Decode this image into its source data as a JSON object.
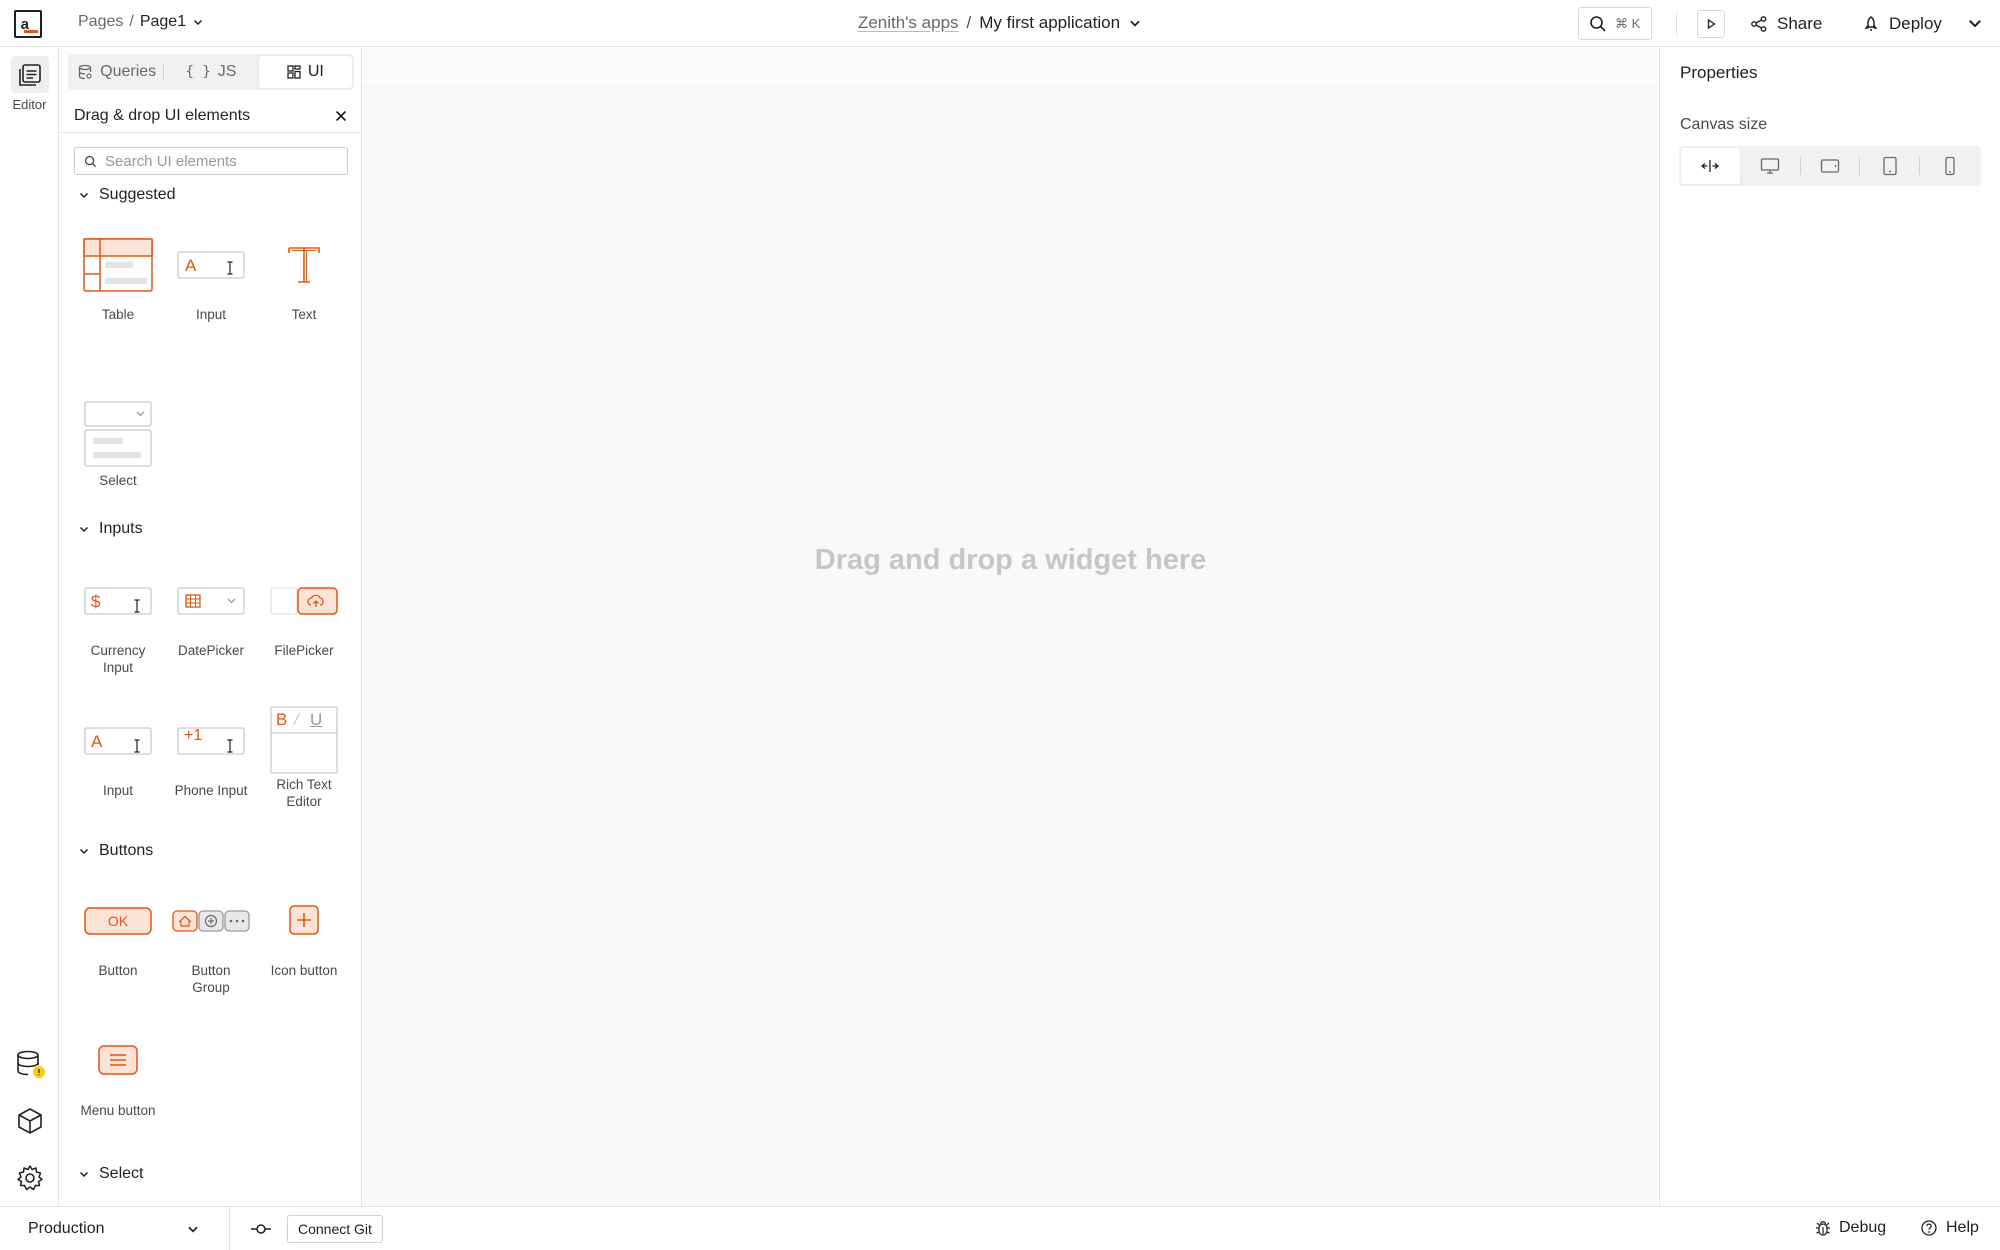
{
  "topbar": {
    "logo_text": "a_",
    "breadcrumb_root": "Pages",
    "breadcrumb_sep": "/",
    "breadcrumb_page": "Page1",
    "workspace": "Zenith's apps",
    "title_sep": "/",
    "app_name": "My first application",
    "search_shortcut": "⌘ K",
    "share_label": "Share",
    "deploy_label": "Deploy"
  },
  "rail": {
    "editor_label": "Editor"
  },
  "panel": {
    "tabs": [
      {
        "label": "Queries",
        "icon": "database-icon"
      },
      {
        "label": "JS",
        "icon": "braces-icon"
      },
      {
        "label": "UI",
        "icon": "grid-icon"
      }
    ],
    "active_tab": "UI",
    "heading": "Drag & drop UI elements",
    "search_placeholder": "Search UI elements",
    "sections": [
      {
        "title": "Suggested",
        "widgets": [
          "Table",
          "Input",
          "Text",
          "Select"
        ]
      },
      {
        "title": "Inputs",
        "widgets": [
          "Currency Input",
          "DatePicker",
          "FilePicker",
          "Input",
          "Phone Input",
          "Rich Text Editor"
        ]
      },
      {
        "title": "Buttons",
        "widgets": [
          "Button",
          "Button Group",
          "Icon button",
          "Menu button"
        ]
      },
      {
        "title": "Select",
        "widgets": []
      }
    ],
    "button_thumb_text": "OK",
    "phone_thumb_text": "+1",
    "rte_thumb_text": [
      "B",
      "/",
      "U"
    ]
  },
  "canvas": {
    "empty_text": "Drag and drop a widget here"
  },
  "properties": {
    "title": "Properties",
    "canvas_size_label": "Canvas size",
    "size_options": [
      "fluid-width-icon",
      "desktop-icon",
      "tablet-landscape-icon",
      "tablet-portrait-icon",
      "mobile-icon"
    ]
  },
  "bottombar": {
    "environment": "Production",
    "connect_git_label": "Connect Git",
    "debug_label": "Debug",
    "help_label": "Help"
  },
  "colors": {
    "accent": "#e15615",
    "accent_light": "#fde3d5",
    "text_dark": "#231f20",
    "border": "#e3e3e3"
  }
}
